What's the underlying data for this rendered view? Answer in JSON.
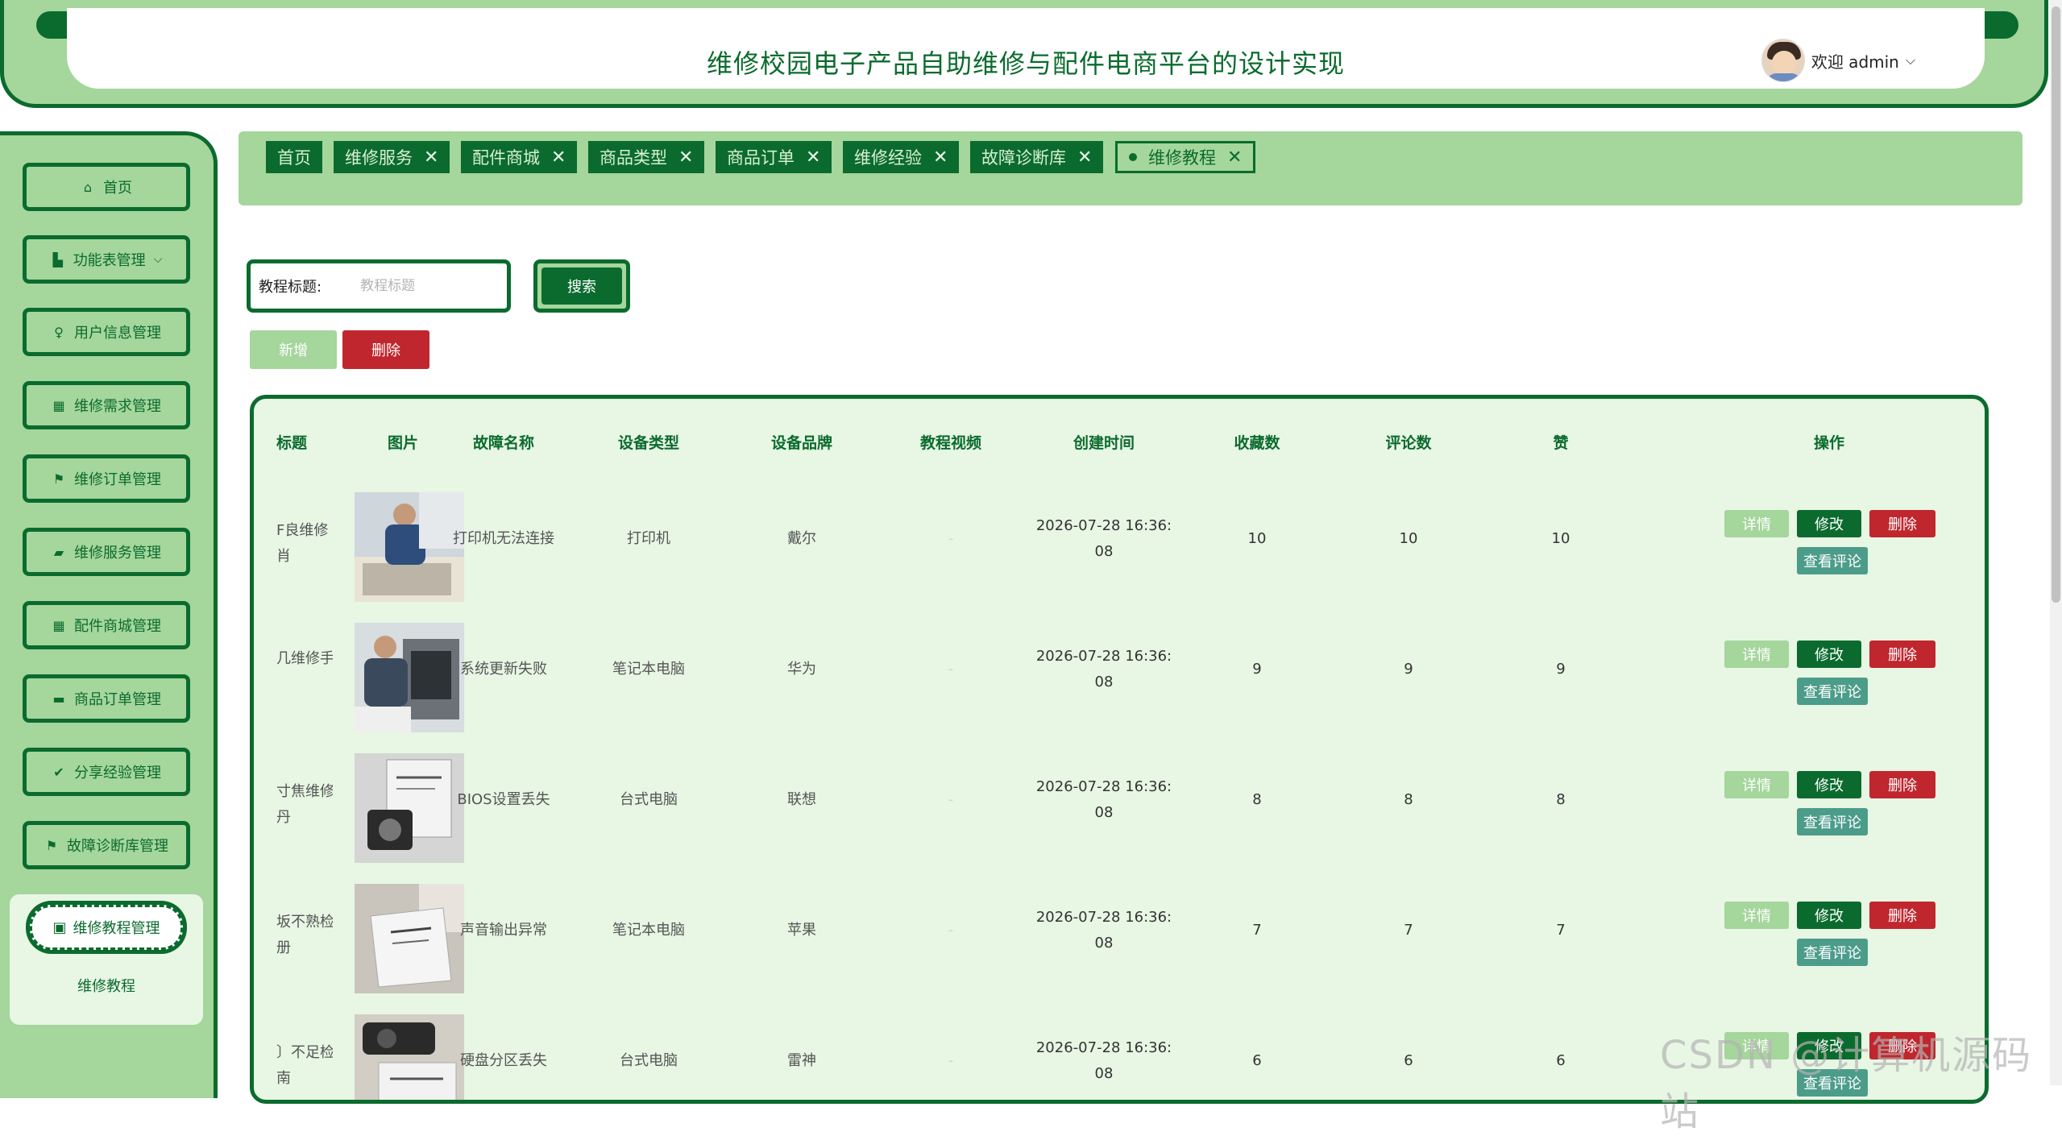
{
  "header": {
    "title": "维修校园电子产品自助维修与配件电商平台的设计实现",
    "welcome": "欢迎 admin"
  },
  "sidebar": {
    "items": [
      {
        "label": "首页",
        "icon": "home-icon"
      },
      {
        "label": "功能表管理",
        "icon": "building-icon"
      },
      {
        "label": "用户信息管理",
        "icon": "user-icon"
      },
      {
        "label": "维修需求管理",
        "icon": "grid-icon"
      },
      {
        "label": "维修订单管理",
        "icon": "flag-icon"
      },
      {
        "label": "维修服务管理",
        "icon": "folder-icon"
      },
      {
        "label": "配件商城管理",
        "icon": "grid-icon"
      },
      {
        "label": "商品订单管理",
        "icon": "card-icon"
      },
      {
        "label": "分享经验管理",
        "icon": "check-circle-icon"
      },
      {
        "label": "故障诊断库管理",
        "icon": "flag-icon"
      }
    ],
    "active": {
      "label": "维修教程管理",
      "icon": "document-icon"
    },
    "submenu": "维修教程"
  },
  "tags": [
    {
      "label": "首页",
      "closable": false
    },
    {
      "label": "维修服务",
      "closable": true
    },
    {
      "label": "配件商城",
      "closable": true
    },
    {
      "label": "商品类型",
      "closable": true
    },
    {
      "label": "商品订单",
      "closable": true
    },
    {
      "label": "维修经验",
      "closable": true
    },
    {
      "label": "故障诊断库",
      "closable": true
    },
    {
      "label": "维修教程",
      "closable": true,
      "active": true
    }
  ],
  "search": {
    "label": "教程标题:",
    "placeholder": "教程标题",
    "button": "搜索"
  },
  "actions": {
    "add": "新增",
    "delete": "删除"
  },
  "table": {
    "columns": [
      "标题",
      "图片",
      "故障名称",
      "设备类型",
      "设备品牌",
      "教程视频",
      "创建时间",
      "收藏数",
      "评论数",
      "赞",
      "操作"
    ],
    "rows": [
      {
        "title_line1": "F良维修",
        "title_line2": "肖",
        "fault": "打印机无法连接",
        "device": "打印机",
        "brand": "戴尔",
        "video": "-",
        "time1": "2026-07-28 16:36:",
        "time2": "08",
        "fav": "10",
        "comments": "10",
        "likes": "10"
      },
      {
        "title_line1": "几维修手",
        "title_line2": "",
        "fault": "系统更新失败",
        "device": "笔记本电脑",
        "brand": "华为",
        "video": "-",
        "time1": "2026-07-28 16:36:",
        "time2": "08",
        "fav": "9",
        "comments": "9",
        "likes": "9"
      },
      {
        "title_line1": "寸焦维修",
        "title_line2": "丹",
        "fault": "BIOS设置丢失",
        "device": "台式电脑",
        "brand": "联想",
        "video": "-",
        "time1": "2026-07-28 16:36:",
        "time2": "08",
        "fav": "8",
        "comments": "8",
        "likes": "8"
      },
      {
        "title_line1": "坂不熟检",
        "title_line2": "册",
        "fault": "声音输出异常",
        "device": "笔记本电脑",
        "brand": "苹果",
        "video": "-",
        "time1": "2026-07-28 16:36:",
        "time2": "08",
        "fav": "7",
        "comments": "7",
        "likes": "7"
      },
      {
        "title_line1": "〕不足检",
        "title_line2": "南",
        "fault": "硬盘分区丢失",
        "device": "台式电脑",
        "brand": "雷神",
        "video": "-",
        "time1": "2026-07-28 16:36:",
        "time2": "08",
        "fav": "6",
        "comments": "6",
        "likes": "6"
      }
    ],
    "op_labels": {
      "detail": "详情",
      "edit": "修改",
      "remove": "删除",
      "comment": "查看评论"
    }
  },
  "watermark": "CSDN @计算机源码站",
  "colors": {
    "primary": "#0b6b2e",
    "light": "#a5d69c",
    "pale": "#e8f6e4",
    "danger": "#c0262d",
    "teal": "#4c9c8a"
  }
}
